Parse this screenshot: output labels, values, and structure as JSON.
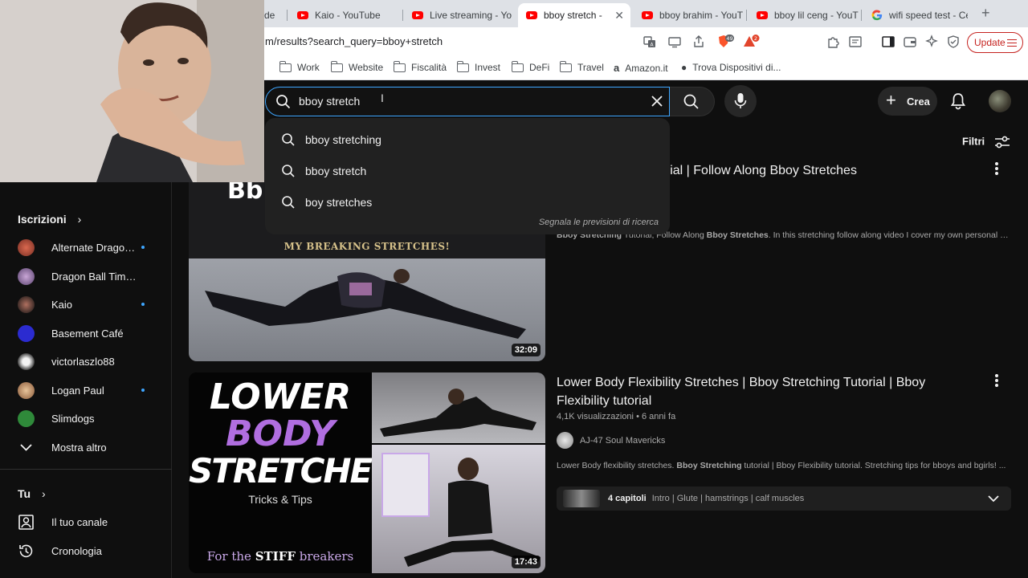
{
  "browser": {
    "tabs": [
      {
        "title": "de",
        "icon": "youtube-icon"
      },
      {
        "title": "Kaio - YouTube",
        "icon": "youtube-icon"
      },
      {
        "title": "Live streaming - Yo",
        "icon": "youtube-icon"
      },
      {
        "title": "bboy stretch - ",
        "icon": "youtube-icon",
        "active": true
      },
      {
        "title": "bboy brahim - YouT",
        "icon": "youtube-icon"
      },
      {
        "title": "bboy lil ceng - YouT",
        "icon": "youtube-icon"
      },
      {
        "title": "wifi speed test - Ce",
        "icon": "google-icon"
      }
    ],
    "url": "m/results?search_query=bboy+stretch",
    "shield_count": "49",
    "alert_count": "2",
    "update_label": "Update",
    "bookmarks": [
      {
        "label": "Work",
        "icon": "folder-icon"
      },
      {
        "label": "Website",
        "icon": "folder-icon"
      },
      {
        "label": "Fiscalità",
        "icon": "folder-icon"
      },
      {
        "label": "Invest",
        "icon": "folder-icon"
      },
      {
        "label": "DeFi",
        "icon": "folder-icon"
      },
      {
        "label": "Travel",
        "icon": "folder-icon"
      },
      {
        "label": "Amazon.it",
        "icon": "amazon-icon"
      },
      {
        "label": "Trova Dispositivi di...",
        "icon": "apple-icon"
      }
    ]
  },
  "youtube": {
    "search": {
      "query": "bboy stretch",
      "suggestions": [
        "bboy stretching",
        "bboy stretch",
        "boy stretches"
      ],
      "report": "Segnala le previsioni di ricerca"
    },
    "create_label": "Crea",
    "filters_label": "Filtri",
    "sidebar": {
      "subs_title": "Iscrizioni",
      "subscriptions": [
        {
          "name": "Alternate Dragon...",
          "new": true,
          "color": "#b04a3a"
        },
        {
          "name": "Dragon Ball Timelin...",
          "new": false,
          "color": "#8a6a9a"
        },
        {
          "name": "Kaio",
          "new": true,
          "color": "#2a2a2a"
        },
        {
          "name": "Basement Café",
          "new": false,
          "color": "#3a3ab0"
        },
        {
          "name": "victorlaszlo88",
          "new": false,
          "color": "#d8d8d8"
        },
        {
          "name": "Logan Paul",
          "new": true,
          "color": "#c9a074"
        },
        {
          "name": "Slimdogs",
          "new": false,
          "color": "#2f8a3a"
        }
      ],
      "show_more": "Mostra altro",
      "you_title": "Tu",
      "you_items": [
        {
          "label": "Il tuo canale",
          "icon": "channel-icon"
        },
        {
          "label": "Cronologia",
          "icon": "history-icon"
        }
      ]
    },
    "videos": [
      {
        "title_visible": "orial | Follow Along Bboy Stretches",
        "thumb_text": "MY BREAKING STRETCHES!",
        "duration": "32:09",
        "desc_parts": [
          {
            "t": "Bboy Stretching",
            "b": true
          },
          {
            "t": " Tutorial, Follow Along ",
            "b": false
          },
          {
            "t": "Bboy Stretches",
            "b": true
          },
          {
            "t": ". In this stretching follow along video I cover my own personal st...",
            "b": false
          }
        ]
      },
      {
        "title": "Lower Body Flexibility Stretches | Bboy Stretching Tutorial | Bboy Flexibility tutorial",
        "views": "4,1K visualizzazioni",
        "age": "6 anni fa",
        "channel": "AJ-47 Soul Mavericks",
        "thumb_line1": "LOWER",
        "thumb_line2": "BODY",
        "thumb_line3": "STRETCHES",
        "thumb_sub": "Tricks & Tips",
        "thumb_bottom_pre": "For the ",
        "thumb_bottom_bold": "STIFF",
        "thumb_bottom_post": " breakers",
        "duration": "17:43",
        "desc_parts": [
          {
            "t": "Lower Body flexibility stretches. ",
            "b": false
          },
          {
            "t": "Bboy Stretching",
            "b": true
          },
          {
            "t": " tutorial | Bboy Flexibility tutorial. Stretching tips for bboys and bgirls! ...",
            "b": false
          }
        ],
        "chapters_count": "4 capitoli",
        "chapters_list": "Intro | Glute | hamstrings | calf muscles"
      }
    ]
  }
}
